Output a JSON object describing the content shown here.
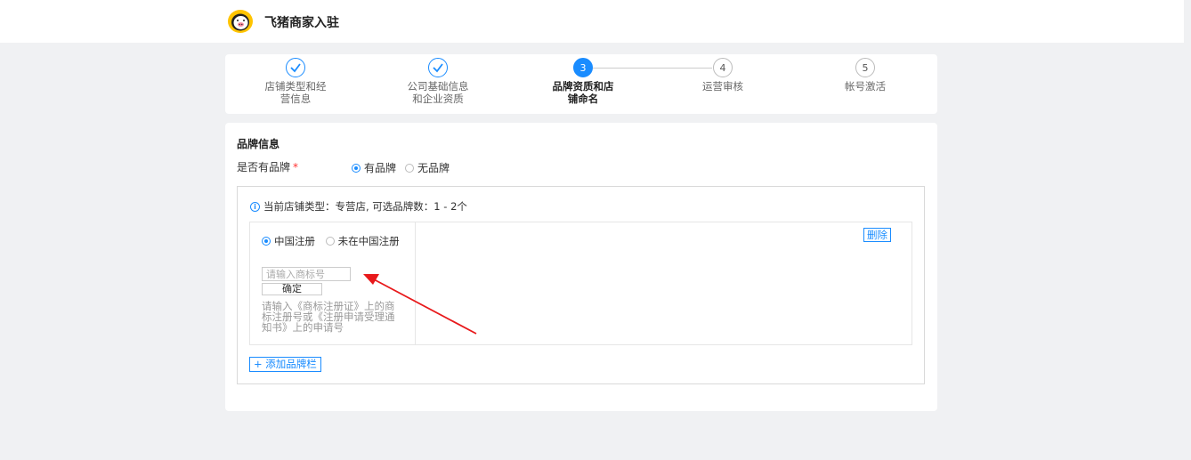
{
  "header": {
    "title": "飞猪商家入驻"
  },
  "steps": [
    {
      "label": "店铺类型和经营信息",
      "status": "done"
    },
    {
      "label": "公司基础信息和企业资质",
      "status": "done"
    },
    {
      "number": "3",
      "label": "品牌资质和店铺命名",
      "status": "current"
    },
    {
      "number": "4",
      "label": "运营审核",
      "status": "todo"
    },
    {
      "number": "5",
      "label": "帐号激活",
      "status": "todo"
    }
  ],
  "brand_section": {
    "title": "品牌信息",
    "question": "是否有品牌",
    "required_mark": "*",
    "options": [
      "有品牌",
      "无品牌"
    ],
    "selected": "有品牌"
  },
  "brand_box": {
    "info": "当前店铺类型：专营店, 可选品牌数：1 - 2个",
    "registration_options": [
      "中国注册",
      "未在中国注册"
    ],
    "registration_selected": "中国注册",
    "trademark_placeholder": "请输入商标号",
    "confirm_label": "确定",
    "hint": "请输入《商标注册证》上的商标注册号或《注册申请受理通知书》上的申请号",
    "delete_label": "删除",
    "add_label": "+ 添加品牌栏"
  },
  "colors": {
    "accent": "#1a8cff",
    "arrow": "#e8191b",
    "required": "#ff3333"
  }
}
